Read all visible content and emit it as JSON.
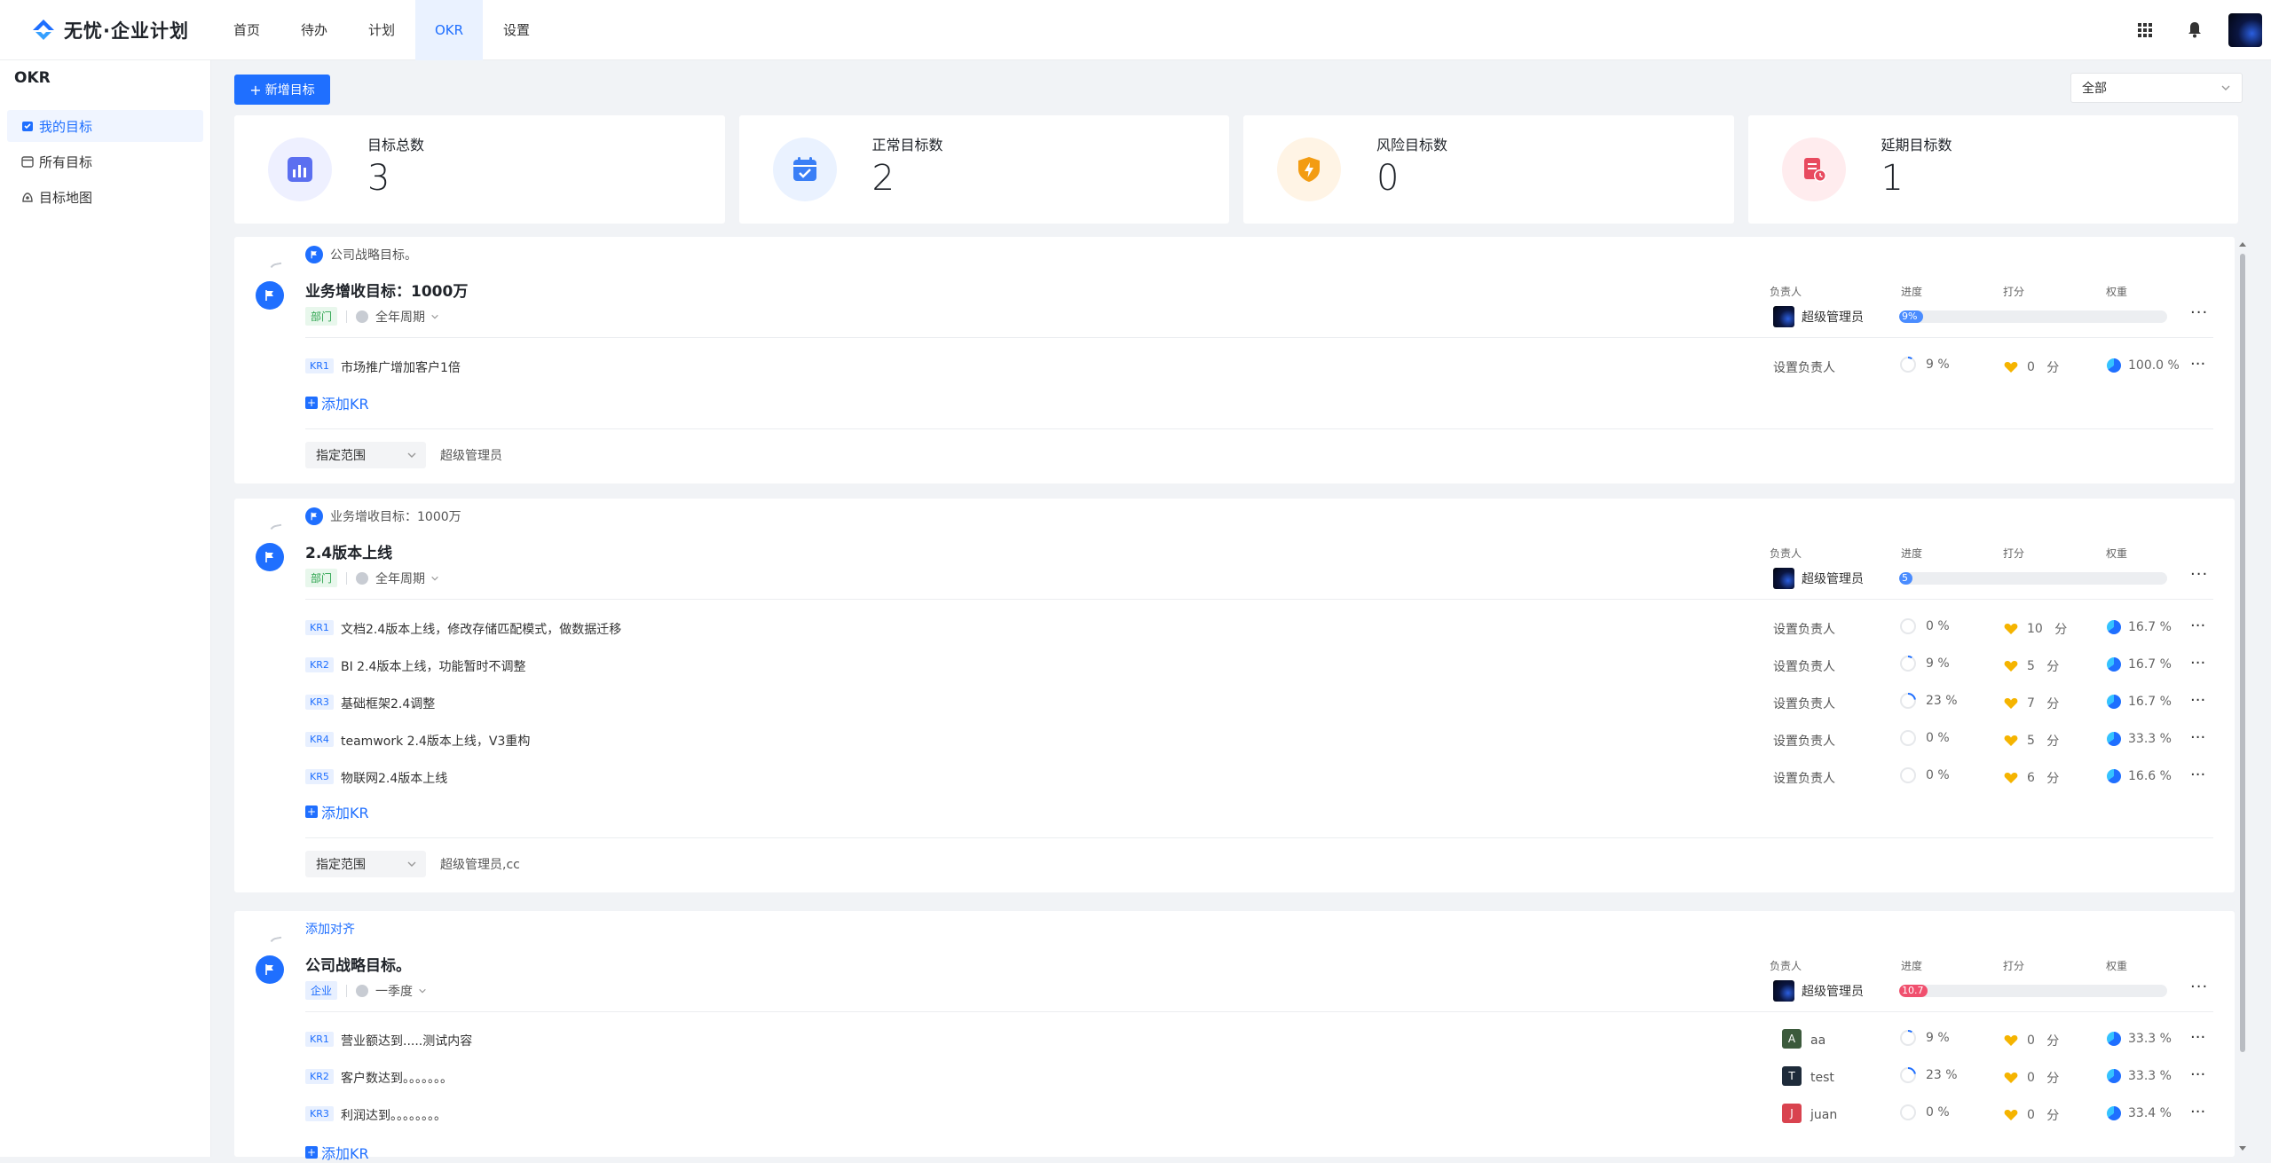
{
  "app": {
    "logo_text": "无忧·企业计划"
  },
  "nav": [
    {
      "label": "首页"
    },
    {
      "label": "待办"
    },
    {
      "label": "计划"
    },
    {
      "label": "OKR",
      "active": true
    },
    {
      "label": "设置"
    }
  ],
  "sidebar": {
    "title": "OKR",
    "items": [
      {
        "label": "我的目标",
        "icon": "my-goals-icon",
        "active": true
      },
      {
        "label": "所有目标",
        "icon": "all-goals-icon"
      },
      {
        "label": "目标地图",
        "icon": "goal-map-icon"
      }
    ]
  },
  "toolbar": {
    "new_button": "新增目标",
    "filter_value": "全部"
  },
  "stats": [
    {
      "label": "目标总数",
      "value": "3",
      "color": "#5b6ff0",
      "bg": "#eef0ff"
    },
    {
      "label": "正常目标数",
      "value": "2",
      "color": "#3a7ff6",
      "bg": "#eaf2ff"
    },
    {
      "label": "风险目标数",
      "value": "0",
      "color": "#f39c12",
      "bg": "#fff4e5"
    },
    {
      "label": "延期目标数",
      "value": "1",
      "color": "#e84a5f",
      "bg": "#ffecee"
    }
  ],
  "columns": {
    "owner": "负责人",
    "progress": "进度",
    "score": "打分",
    "weight": "权重"
  },
  "objectives": [
    {
      "parent": "公司战略目标。",
      "title": "业务增收目标：1000万",
      "tag": "部门",
      "period": "全年周期",
      "owner": "超级管理员",
      "progress_label": "9%",
      "progress": 9,
      "progress_color": "#4a8cff",
      "krs": [
        {
          "tag": "KR1",
          "text": "市场推广增加客户1倍",
          "owner": "设置负责人",
          "progress": "9 %",
          "score": "0",
          "weight": "100.0 %"
        }
      ],
      "add_kr": "添加KR",
      "scope_label": "指定范围",
      "scope_users": "超级管理员"
    },
    {
      "parent": "业务增收目标：1000万",
      "title": "2.4版本上线",
      "tag": "部门",
      "period": "全年周期",
      "owner": "超级管理员",
      "progress_label": "5",
      "progress": 5,
      "progress_color": "#4a8cff",
      "krs": [
        {
          "tag": "KR1",
          "text": "文档2.4版本上线，修改存储匹配模式，做数据迁移",
          "owner": "设置负责人",
          "progress": "0 %",
          "score": "10",
          "weight": "16.7 %"
        },
        {
          "tag": "KR2",
          "text": "BI 2.4版本上线，功能暂时不调整",
          "owner": "设置负责人",
          "progress": "9 %",
          "score": "5",
          "weight": "16.7 %"
        },
        {
          "tag": "KR3",
          "text": "基础框架2.4调整",
          "owner": "设置负责人",
          "progress": "23 %",
          "score": "7",
          "weight": "16.7 %"
        },
        {
          "tag": "KR4",
          "text": "teamwork 2.4版本上线，V3重构",
          "owner": "设置负责人",
          "progress": "0 %",
          "score": "5",
          "weight": "33.3 %"
        },
        {
          "tag": "KR5",
          "text": "物联网2.4版本上线",
          "owner": "设置负责人",
          "progress": "0 %",
          "score": "6",
          "weight": "16.6 %"
        }
      ],
      "add_kr": "添加KR",
      "scope_label": "指定范围",
      "scope_users": "超级管理员,cc"
    },
    {
      "parent": "添加对齐",
      "title": "公司战略目标。",
      "tag": "企业",
      "period": "一季度",
      "owner": "超级管理员",
      "progress_label": "10.7",
      "progress": 10.7,
      "progress_color": "#f0506e",
      "krs": [
        {
          "tag": "KR1",
          "text": "营业额达到.....测试内容",
          "owner": "aa",
          "initial": "A",
          "initial_color": "#3c5a3c",
          "progress": "9 %",
          "score": "0",
          "weight": "33.3 %"
        },
        {
          "tag": "KR2",
          "text": "客户数达到。。。。。。。",
          "owner": "test",
          "initial": "T",
          "initial_color": "#1e2b3a",
          "progress": "23 %",
          "score": "0",
          "weight": "33.3 %"
        },
        {
          "tag": "KR3",
          "text": "利润达到。。。。。。。。",
          "owner": "juan",
          "initial": "J",
          "initial_color": "#d9434f",
          "progress": "0 %",
          "score": "0",
          "weight": "33.4 %"
        }
      ],
      "add_kr": "添加KR"
    }
  ],
  "units": {
    "score": "分"
  }
}
